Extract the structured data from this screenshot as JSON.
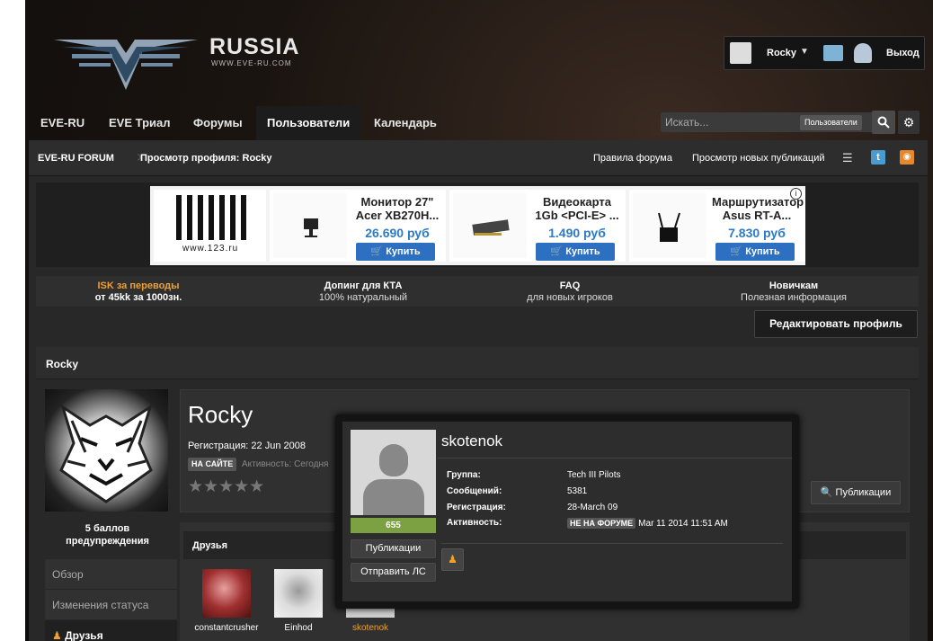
{
  "header": {
    "logo_text": "RUSSIA",
    "logo_url": "WWW.EVE-RU.COM",
    "user": {
      "name": "Rocky",
      "logout": "Выход"
    }
  },
  "nav": {
    "items": [
      "EVE-RU",
      "EVE Триал",
      "Форумы",
      "Пользователи",
      "Календарь"
    ],
    "active": "Пользователи"
  },
  "search": {
    "placeholder": "Искать...",
    "scope": "Пользователи"
  },
  "breadcrumb": {
    "root": "EVE-RU FORUM",
    "current": "Просмотр профиля: Rocky",
    "rules": "Правила форума",
    "new_posts": "Просмотр новых публикаций"
  },
  "ad": {
    "shop_url": "www.123.ru",
    "products": [
      {
        "name": "Монитор 27\" Acer XB270H...",
        "price": "26.690 руб",
        "buy": "Купить"
      },
      {
        "name": "Видеокарта 1Gb <PCI-E> ...",
        "price": "1.490 руб",
        "buy": "Купить"
      },
      {
        "name": "Маршрутизатор Asus RT-A...",
        "price": "7.830 руб",
        "buy": "Купить"
      }
    ]
  },
  "links": [
    {
      "title": "ISK за переводы",
      "sub": "от 45kk за 1000зн."
    },
    {
      "title": "Допинг для КТА",
      "sub": "100% натуральный"
    },
    {
      "title": "FAQ",
      "sub": "для новых игроков"
    },
    {
      "title": "Новичкам",
      "sub": "Полезная информация"
    }
  ],
  "edit_profile": "Редактировать профиль",
  "profile": {
    "title_bar": "Rocky",
    "name": "Rocky",
    "registration": "Регистрация: 22 Jun 2008",
    "online_badge": "НА САЙТЕ",
    "activity": "Активность: Сегодня",
    "stars": "★★★★★",
    "publications_button": "Публикации",
    "warnings": "5 баллов предупреждения",
    "side_nav": [
      "Обзор",
      "Изменения статуса",
      "Друзья"
    ],
    "friends_title": "Друзья",
    "friends": [
      "constantcrusher",
      "Einhod",
      "skotenok"
    ]
  },
  "hovercard": {
    "name": "skotenok",
    "reputation": "655",
    "rows": [
      {
        "key": "Группа:",
        "value": "Tech III Pilots"
      },
      {
        "key": "Сообщений:",
        "value": "5381"
      },
      {
        "key": "Регистрация:",
        "value": "28-March 09"
      },
      {
        "key": "Активность:",
        "badge": "НЕ НА ФОРУМЕ",
        "value": "Mar 11 2014 11:51 AM"
      }
    ],
    "publications_button": "Публикации",
    "send_pm_button": "Отправить ЛС"
  }
}
